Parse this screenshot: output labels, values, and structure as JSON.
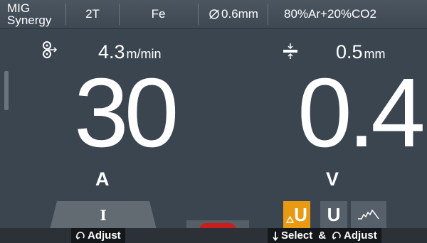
{
  "header": {
    "process_line1": "MIG",
    "process_line2": "Synergy",
    "trigger_mode": "2T",
    "material": "Fe",
    "wire_diameter": "0.6mm",
    "gas": "80%Ar+20%CO2"
  },
  "params": {
    "wire_speed_value": "4.3",
    "wire_speed_unit": "m/min",
    "thickness_value": "0.5",
    "thickness_unit": "mm",
    "current_value": "30",
    "current_unit": "A",
    "voltage_value": "0.4",
    "voltage_unit": "V"
  },
  "tabs": {
    "current_tab_label": "I",
    "delta_u_label": "U",
    "u_label": "U"
  },
  "footer": {
    "adjust_left": "Adjust",
    "select_label": "Select",
    "amp": "&",
    "adjust_right": "Adjust"
  },
  "colors": {
    "accent": "#e89a12",
    "background": "#3a4550",
    "red_indicator": "#c81e1e"
  },
  "icons": [
    "wire-feed-icon",
    "thickness-icon",
    "diameter-icon",
    "rotate-knob-icon",
    "down-arrow-icon",
    "ramp-icon",
    "delta-icon"
  ]
}
